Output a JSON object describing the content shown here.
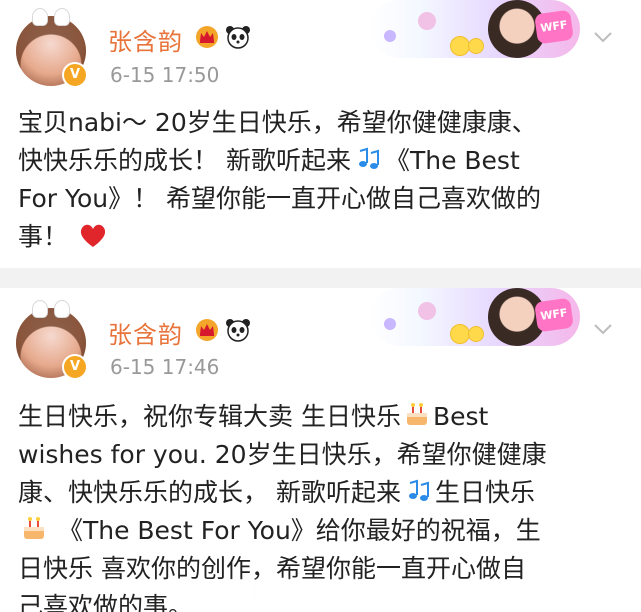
{
  "colors": {
    "username": "#e8743b",
    "timestamp": "#999999",
    "text": "#222222",
    "divider": "#f2f2f2",
    "heart": "#e0262b",
    "accent_pink": "#ff74c5"
  },
  "icons": {
    "crown": "crown-icon",
    "panda": "panda-icon",
    "heart": "heart-icon",
    "note": "music-note-icon",
    "cake": "cake-icon",
    "chevron": "chevron-down-icon",
    "verified": "verified-badge-icon"
  },
  "posts": [
    {
      "username": "张含韵",
      "timestamp": "6-15 17:50",
      "banner_tag": "WFF",
      "lines": [
        "宝贝nabi～ 20岁生日快乐，希望你健健康康、",
        "快快乐乐的成长！  新歌听起来",
        "《The Best",
        "For You》！ 希望你能一直开心做自己喜欢做的",
        "事！"
      ]
    },
    {
      "username": "张含韵",
      "timestamp": "6-15 17:46",
      "banner_tag": "WFF",
      "lines": [
        "生日快乐，祝你专辑大卖  生日快乐",
        "Best",
        "wishes for you.  20岁生日快乐，希望你健健康",
        "康、快快乐乐的成长，  新歌听起来",
        "生日快乐",
        "《The Best For You》给你最好的祝福，生",
        "日快乐  喜欢你的创作，希望你能一直开心做自",
        "己喜欢做的事。"
      ]
    }
  ]
}
